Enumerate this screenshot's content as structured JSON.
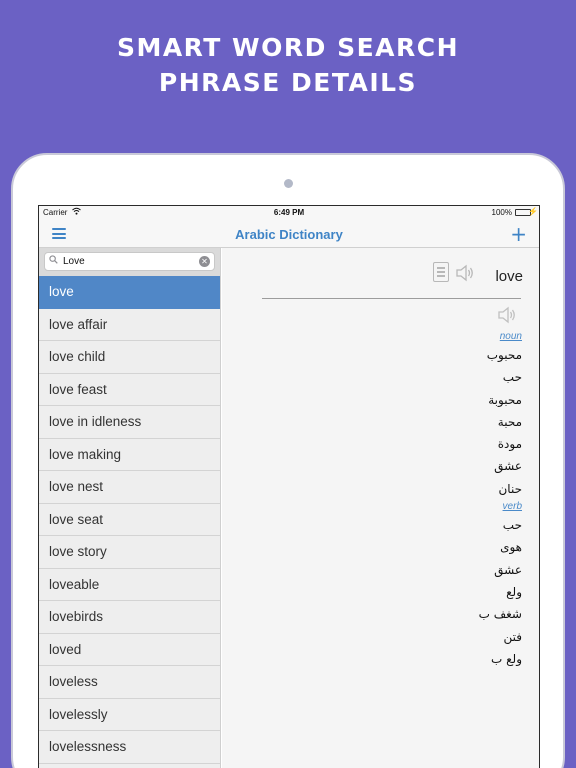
{
  "headline": {
    "line1": "SMART WORD SEARCH",
    "line2": "PHRASE DETAILS"
  },
  "statusbar": {
    "carrier": "Carrier",
    "time": "6:49 PM",
    "battery": "100%",
    "battery_level": 1.0
  },
  "navbar": {
    "title": "Arabic Dictionary"
  },
  "search": {
    "value": "Love",
    "placeholder": "Search"
  },
  "wordlist": [
    "love",
    "love affair",
    "love child",
    "love feast",
    "love in idleness",
    "love making",
    "love nest",
    "love seat",
    "love story",
    "loveable",
    "lovebirds",
    "loved",
    "loveless",
    "lovelessly",
    "lovelessness"
  ],
  "selected_index": 0,
  "detail": {
    "headword": "love",
    "sections": [
      {
        "pos": "noun",
        "translations": [
          "محبوب",
          "حب",
          "محبوبة",
          "محبة",
          "مودة",
          "عشق",
          "حنان"
        ]
      },
      {
        "pos": "verb",
        "translations": [
          "حب",
          "هوى",
          "عشق",
          "ولع",
          "شغف ب",
          "فتن",
          "ولع ب"
        ]
      }
    ]
  },
  "colors": {
    "background": "#6b61c4",
    "accent": "#3f84c6",
    "selected_row": "#5087c7",
    "pos_link": "#4a8ac9"
  },
  "icons": [
    "wifi-icon",
    "menu-icon",
    "plus-icon",
    "search-icon",
    "clear-icon",
    "document-icon",
    "speaker-icon"
  ]
}
